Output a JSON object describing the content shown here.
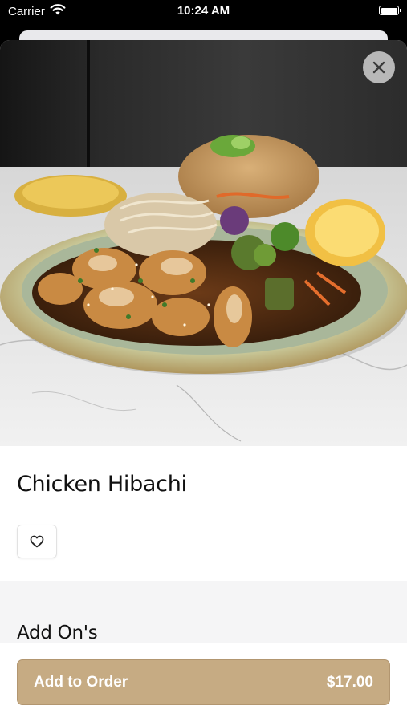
{
  "status_bar": {
    "carrier": "Carrier",
    "time": "10:24 AM"
  },
  "item": {
    "title": "Chicken Hibachi",
    "image_alt": "Chicken Hibachi plate"
  },
  "addons": {
    "title": "Add On's"
  },
  "order_button": {
    "label": "Add to Order",
    "price": "$17.00"
  },
  "colors": {
    "accent": "#c6ab83",
    "close_button_bg": "#c8c8c8"
  },
  "icons": {
    "close": "close-icon",
    "favorite": "heart-icon",
    "wifi": "wifi-icon",
    "battery": "battery-icon"
  }
}
